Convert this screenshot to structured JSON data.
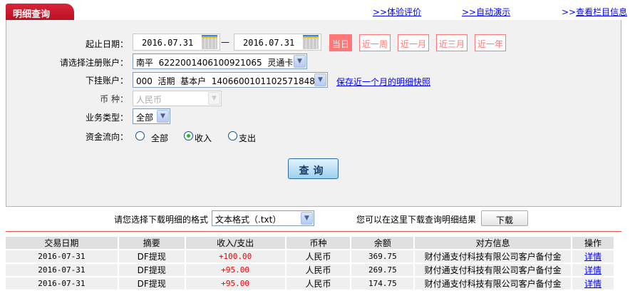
{
  "header": {
    "title": "明细查询",
    "links": [
      ">>体验评价",
      ">>自动演示",
      ">>查看栏目信息"
    ],
    "link_prefix": ">>",
    "link_texts": [
      "体验评价",
      "自动演示",
      "查看栏目信息"
    ]
  },
  "form": {
    "date_label": "起止日期：",
    "date_start": "2016.07.31",
    "date_sep": "—",
    "date_end": "2016.07.31",
    "quick_ranges": [
      "当日",
      "近一周",
      "近一月",
      "近三月",
      "近一年"
    ],
    "quick_selected": "当日",
    "account_label": "请选择注册账户：",
    "account_value": "南平  6222001406100921065  灵通卡",
    "sub_account_label": "下挂账户：",
    "sub_account_value": "000  活期  基本户  1406600101102571848",
    "snapshot_link": "保存近一个月的明细快照",
    "currency_label": "币      种：",
    "currency_value": "人民币",
    "biz_type_label": "业务类型：",
    "biz_type_value": "全部",
    "flow_label": "资金流向：",
    "flow_options": [
      "全部",
      "收入",
      "支出"
    ],
    "flow_selected": "收入",
    "query_button": "查询"
  },
  "download": {
    "format_label": "请您选择下载明细的格式",
    "format_value": "文本格式（.txt）",
    "hint": "您可以在这里下载查询明细结果",
    "button": "下载"
  },
  "table": {
    "headers": [
      "交易日期",
      "摘要",
      "收入/支出",
      "币种",
      "余额",
      "对方信息",
      "操作"
    ],
    "rows": [
      [
        "2016-07-31",
        "DF提现",
        "+100.00",
        "人民币",
        "369.75",
        "财付通支付科技有限公司客户备付金",
        "详情"
      ],
      [
        "2016-07-31",
        "DF提现",
        "+95.00",
        "人民币",
        "269.75",
        "财付通支付科技有限公司客户备付金",
        "详情"
      ],
      [
        "2016-07-31",
        "DF提现",
        "+95.00",
        "人民币",
        "174.75",
        "财付通支付科技有限公司客户备付金",
        "详情"
      ]
    ]
  },
  "colors": {
    "brand_red": "#c8172b",
    "quick_range": "#ff7777",
    "link": "#0000ff",
    "amount": "#e00000"
  }
}
